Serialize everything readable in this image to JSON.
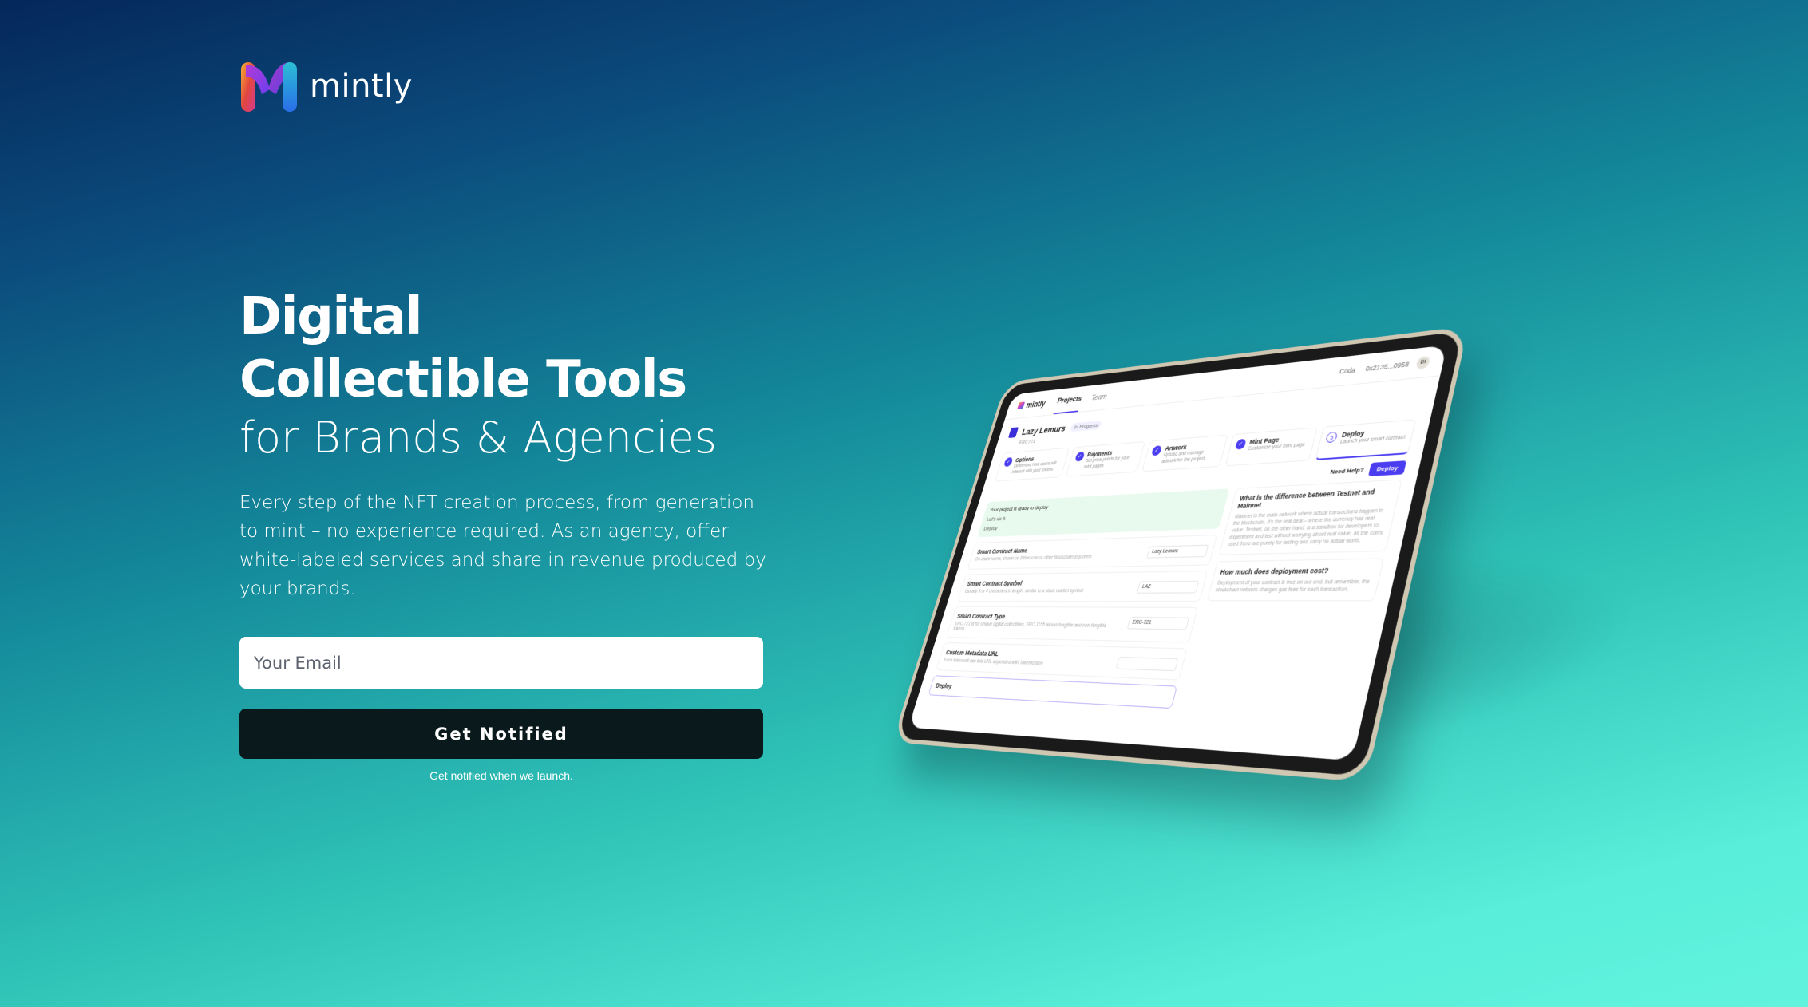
{
  "brand": {
    "name": "mintly"
  },
  "hero": {
    "title_line1": "Digital",
    "title_line2": "Collectible Tools",
    "subtitle": "for Brands & Agencies",
    "description": "Every step of the NFT creation process, from generation to mint – no experience required. As an agency, offer white-labeled services and share in revenue produced by your brands."
  },
  "signup": {
    "email_placeholder": "Your Email",
    "button_label": "Get Notified",
    "hint": "Get notified when we launch."
  },
  "colors": {
    "gradient_top": "#05275a",
    "gradient_bottom": "#62f3de",
    "button_bg": "#0a1a1c",
    "accent": "#4b3df0"
  },
  "tablet": {
    "app_name": "mintly",
    "tabs": [
      "Projects",
      "Team"
    ],
    "workspace": "Coda",
    "wallet": "0x2135...0958",
    "avatar": "DI",
    "project_name": "Lazy Lemurs",
    "project_status": "In Progress",
    "project_standard": "ERC721",
    "steps": [
      {
        "num": "✓",
        "title": "Options",
        "desc": "Determine how users will interact with your tokens"
      },
      {
        "num": "✓",
        "title": "Payments",
        "desc": "Set price points for your mint pages"
      },
      {
        "num": "✓",
        "title": "Artwork",
        "desc": "Upload and manage artwork for the project"
      },
      {
        "num": "✓",
        "title": "Mint Page",
        "desc": "Customize your mint page"
      },
      {
        "num": "5",
        "title": "Deploy",
        "desc": "Launch your smart contract"
      }
    ],
    "help_label": "Need Help?",
    "deploy_label": "Deploy",
    "ready_text": "Your project is ready to deploy",
    "ready_sub": "Let's do it.",
    "ready_action": "Deploy",
    "fields": [
      {
        "label": "Smart Contract Name",
        "desc": "On-chain name, shown on Etherscan or other blockchain explorers",
        "value": "Lazy Lemurs"
      },
      {
        "label": "Smart Contract Symbol",
        "desc": "Usually 3 or 4 characters in length, similar to a stock market symbol",
        "value": "LAZ"
      },
      {
        "label": "Smart Contract Type",
        "desc": "ERC-721 is for unique digital collectibles, ERC-1155 allows fungible and non-fungible tokens",
        "value": "ERC-721"
      },
      {
        "label": "Custom Metadata URL",
        "desc": "Each token will use this URL appended with TokenId.json",
        "value": ""
      }
    ],
    "bottom_label": "Deploy",
    "faqs": [
      {
        "q": "What is the difference between Testnet and Mainnet",
        "a": "Mainnet is the main network where actual transactions happen in the blockchain. It's the real deal – where the currency has real value. Testnet, on the other hand, is a sandbox for developers to experiment and test without worrying about real value, as the coins used there are purely for testing and carry no actual worth."
      },
      {
        "q": "How much does deployment cost?",
        "a": "Deployment of your contract is free on our end, but remember, the blockchain network charges gas fees for each transaction."
      }
    ]
  }
}
